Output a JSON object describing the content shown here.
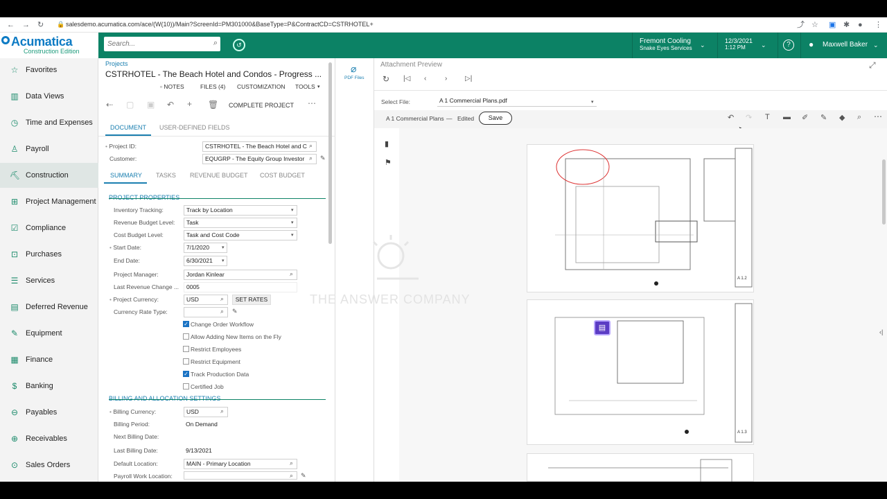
{
  "browser": {
    "url": "salesdemo.acumatica.com/ace/(W(10))/Main?ScreenId=PM301000&BaseType=P&ContractCD=CSTRHOTEL+"
  },
  "header": {
    "logo": "Acumatica",
    "logo_sub": "Construction Edition",
    "search_placeholder": "Search...",
    "company": "Fremont Cooling",
    "branch": "Snake Eyes Services",
    "date": "12/3/2021",
    "time": "1:12 PM",
    "user": "Maxwell Baker",
    "accent": "#0c8265"
  },
  "sidebar": {
    "items": [
      {
        "label": "Favorites",
        "icon": "star-icon"
      },
      {
        "label": "Data Views",
        "icon": "chart-icon"
      },
      {
        "label": "Time and Expenses",
        "icon": "clock-icon"
      },
      {
        "label": "Payroll",
        "icon": "person-icon"
      },
      {
        "label": "Construction",
        "icon": "crane-icon"
      },
      {
        "label": "Project Management",
        "icon": "project-icon"
      },
      {
        "label": "Compliance",
        "icon": "checklist-icon"
      },
      {
        "label": "Purchases",
        "icon": "cart-icon"
      },
      {
        "label": "Services",
        "icon": "services-icon"
      },
      {
        "label": "Deferred Revenue",
        "icon": "deferred-icon"
      },
      {
        "label": "Equipment",
        "icon": "wrench-icon"
      },
      {
        "label": "Finance",
        "icon": "finance-icon"
      },
      {
        "label": "Banking",
        "icon": "dollar-icon"
      },
      {
        "label": "Payables",
        "icon": "payables-icon"
      },
      {
        "label": "Receivables",
        "icon": "receivables-icon"
      },
      {
        "label": "Sales Orders",
        "icon": "sales-icon"
      }
    ]
  },
  "form": {
    "breadcrumb": "Projects",
    "title": "CSTRHOTEL - The Beach Hotel and Condos - Progress ...",
    "links": {
      "notes": "NOTES",
      "files": "FILES (4)",
      "customization": "CUSTOMIZATION",
      "tools": "TOOLS"
    },
    "complete_project": "COMPLETE PROJECT",
    "tabs_top": [
      "DOCUMENT",
      "USER-DEFINED FIELDS"
    ],
    "project_id_label": "Project ID:",
    "project_id": "CSTRHOTEL - The Beach Hotel and C",
    "customer_label": "Customer:",
    "customer": "EQUGRP - The Equity Group Investor",
    "tabs_sub": [
      "SUMMARY",
      "TASKS",
      "REVENUE BUDGET",
      "COST BUDGET"
    ],
    "sections": {
      "project_properties": "PROJECT PROPERTIES",
      "billing": "BILLING AND ALLOCATION SETTINGS"
    },
    "fields": {
      "inventory_tracking_label": "Inventory Tracking:",
      "inventory_tracking": "Track by Location",
      "revenue_budget_level_label": "Revenue Budget Level:",
      "revenue_budget_level": "Task",
      "cost_budget_level_label": "Cost Budget Level:",
      "cost_budget_level": "Task and Cost Code",
      "start_date_label": "Start Date:",
      "start_date": "7/1/2020",
      "end_date_label": "End Date:",
      "end_date": "6/30/2021",
      "project_manager_label": "Project Manager:",
      "project_manager": "Jordan Kinlear",
      "last_revenue_change_label": "Last Revenue Change ...",
      "last_revenue_change": "0005",
      "project_currency_label": "Project Currency:",
      "project_currency": "USD",
      "set_rates": "SET RATES",
      "currency_rate_type_label": "Currency Rate Type:",
      "billing_currency_label": "Billing Currency:",
      "billing_currency": "USD",
      "billing_period_label": "Billing Period:",
      "billing_period": "On Demand",
      "next_billing_date_label": "Next Billing Date:",
      "last_billing_date_label": "Last Billing Date:",
      "last_billing_date": "9/13/2021",
      "default_location_label": "Default Location:",
      "default_location": "MAIN - Primary Location",
      "payroll_work_location_label": "Payroll Work Location:"
    },
    "checkboxes": [
      {
        "label": "Change Order Workflow",
        "checked": true
      },
      {
        "label": "Allow Adding New Items on the Fly",
        "checked": false
      },
      {
        "label": "Restrict Employees",
        "checked": false
      },
      {
        "label": "Restrict Equipment",
        "checked": false
      },
      {
        "label": "Track Production Data",
        "checked": true
      },
      {
        "label": "Certified Job",
        "checked": false
      }
    ]
  },
  "preview": {
    "pdf_files_label": "PDF Files",
    "title": "Attachment Preview",
    "select_file_label": "Select File:",
    "select_file": "A 1 Commercial Plans.pdf",
    "doc_name": "A 1 Commercial Plans",
    "separator": "—",
    "edited": "Edited",
    "save": "Save",
    "watermark": "THE ANSWER COMPANY",
    "page_labels": [
      "A 1.2",
      "A 1.3"
    ]
  }
}
